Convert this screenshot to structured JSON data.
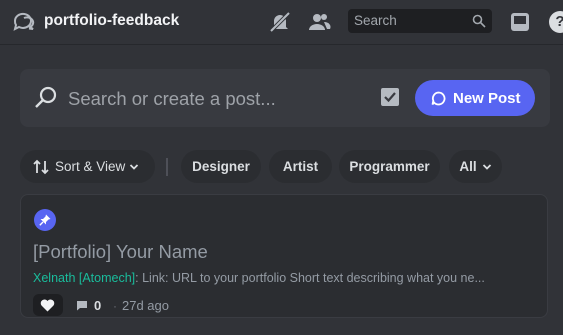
{
  "header": {
    "channel_name": "portfolio-feedback",
    "search_placeholder": "Search",
    "help_glyph": "?",
    "icons": [
      "threads-icon",
      "mute-bell-icon",
      "members-icon",
      "search-icon",
      "inbox-icon",
      "help-icon"
    ]
  },
  "post_bar": {
    "placeholder": "Search or create a post...",
    "new_post_label": "New Post"
  },
  "filters": {
    "sort_label": "Sort & View",
    "tags": [
      "Designer",
      "Artist",
      "Programmer"
    ],
    "all_label": "All"
  },
  "post": {
    "title": "[Portfolio] Your Name",
    "author": "Xelnath [Atomech]",
    "preview": ": Link: URL to your portfolio Short text describing what you ne...",
    "comment_count": "0",
    "separator": "·",
    "age": "27d ago"
  },
  "colors": {
    "background": "#313338",
    "accent": "#5865f2",
    "author": "#1abc9c",
    "card": "#2b2d31"
  }
}
